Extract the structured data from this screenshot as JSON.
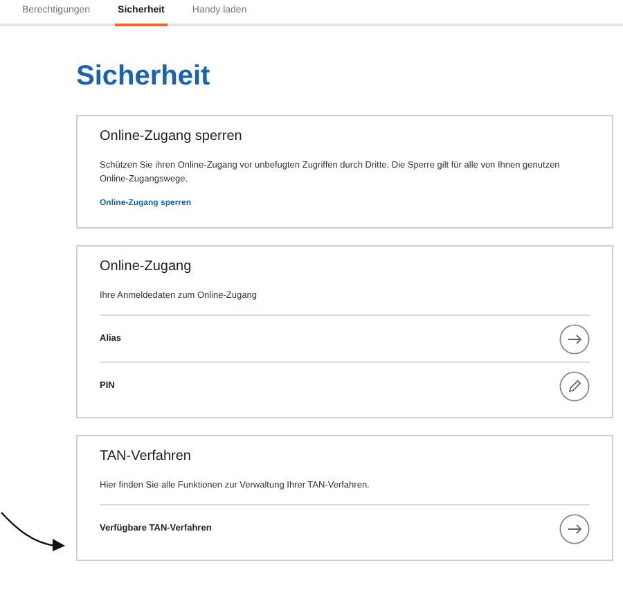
{
  "tabs": [
    {
      "label": "Berechtigungen",
      "selected": false
    },
    {
      "label": "Sicherheit",
      "selected": true
    },
    {
      "label": "Handy laden",
      "selected": false
    }
  ],
  "heading": "Sicherheit",
  "cards": [
    {
      "title": "Online-Zugang sperren",
      "description": "Schützen Sie ihren Online-Zugang vor unbefugten Zugriffen durch Dritte. Die Sperre gilt für alle von Ihnen genutzen Online-Zugangswege.",
      "link": "Online-Zugang sperren"
    },
    {
      "title": "Online-Zugang",
      "description": "Ihre Anmeldedaten zum Online-Zugang",
      "rows": [
        {
          "label": "Alias",
          "kind": "arrow"
        },
        {
          "label": "PIN",
          "kind": "edit"
        }
      ]
    },
    {
      "title": "TAN-Verfahren",
      "description": "Hier finden Sie alle Funktionen zur Verwaltung Ihrer TAN-Verfahren.",
      "rows": [
        {
          "label": "Verfügbare TAN-Verfahren",
          "kind": "arrow"
        }
      ]
    }
  ]
}
